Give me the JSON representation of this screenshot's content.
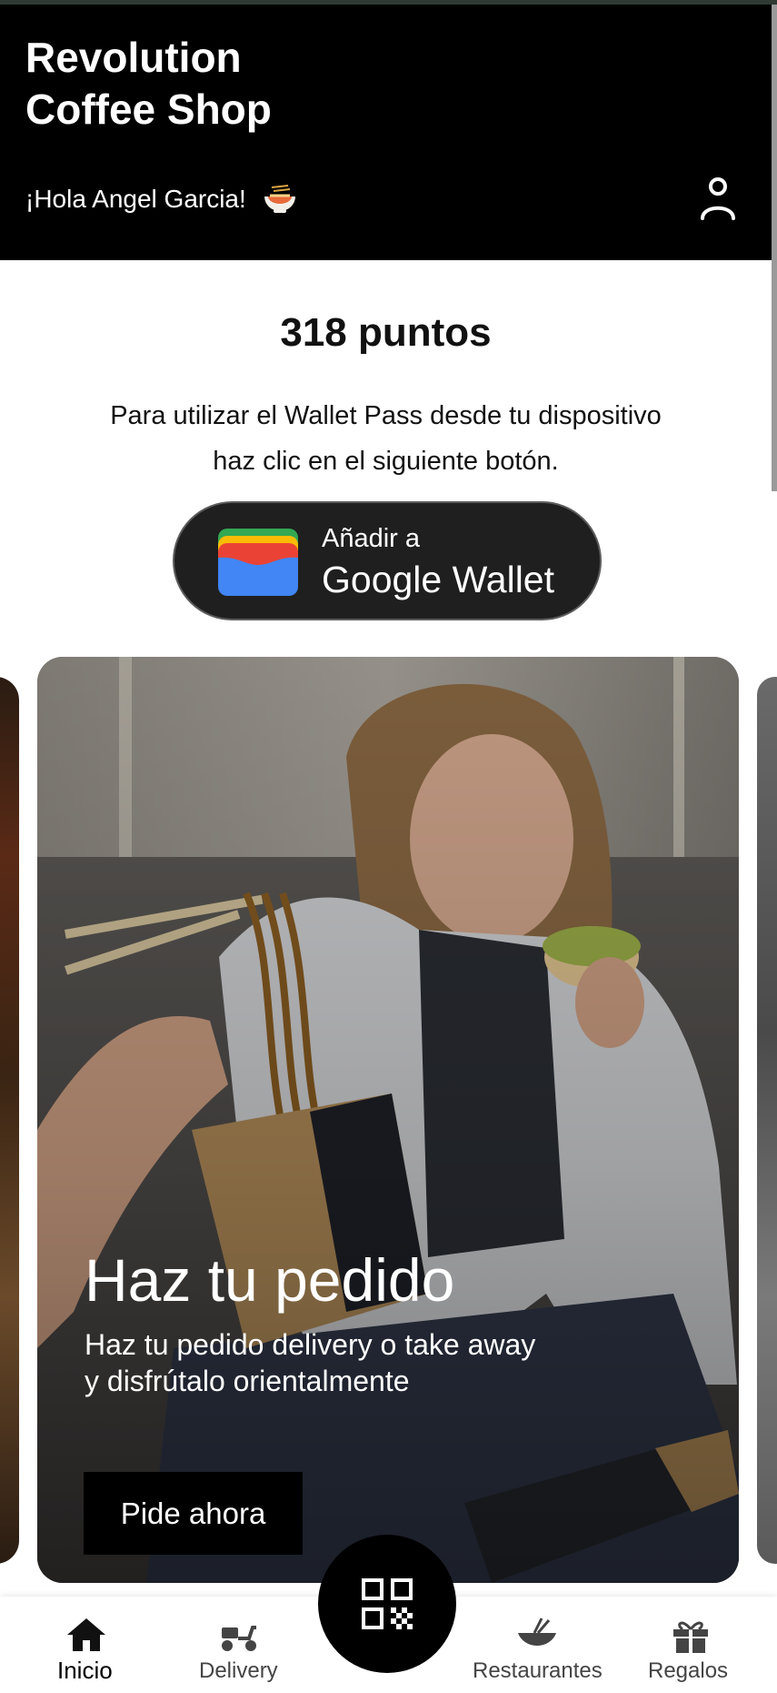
{
  "header": {
    "title_line1": "Revolution",
    "title_line2": "Coffee Shop",
    "greeting": "¡Hola Angel Garcia!",
    "greeting_icon": "ramen-bowl-icon",
    "profile_icon": "user-icon",
    "background": "#000000"
  },
  "points": {
    "label": "318 puntos",
    "value": 318
  },
  "wallet": {
    "instructions_line1": "Para utilizar el Wallet Pass desde tu dispositivo",
    "instructions_line2": "haz clic en el siguiente botón.",
    "button_small": "Añadir a",
    "button_big": "Google Wallet"
  },
  "promo": {
    "title": "Haz tu pedido",
    "subtitle_line1": "Haz tu pedido delivery o take away",
    "subtitle_line2": "y disfrútalo orientalmente",
    "cta": "Pide ahora"
  },
  "bottom_nav": {
    "items": [
      {
        "label": "Inicio",
        "icon": "home-icon",
        "active": true
      },
      {
        "label": "Delivery",
        "icon": "scooter-icon",
        "active": false
      },
      {
        "label": "Restaurantes",
        "icon": "bowl-chopsticks-icon",
        "active": false
      },
      {
        "label": "Regalos",
        "icon": "gift-icon",
        "active": false
      }
    ],
    "fab_icon": "qr-code-icon"
  }
}
